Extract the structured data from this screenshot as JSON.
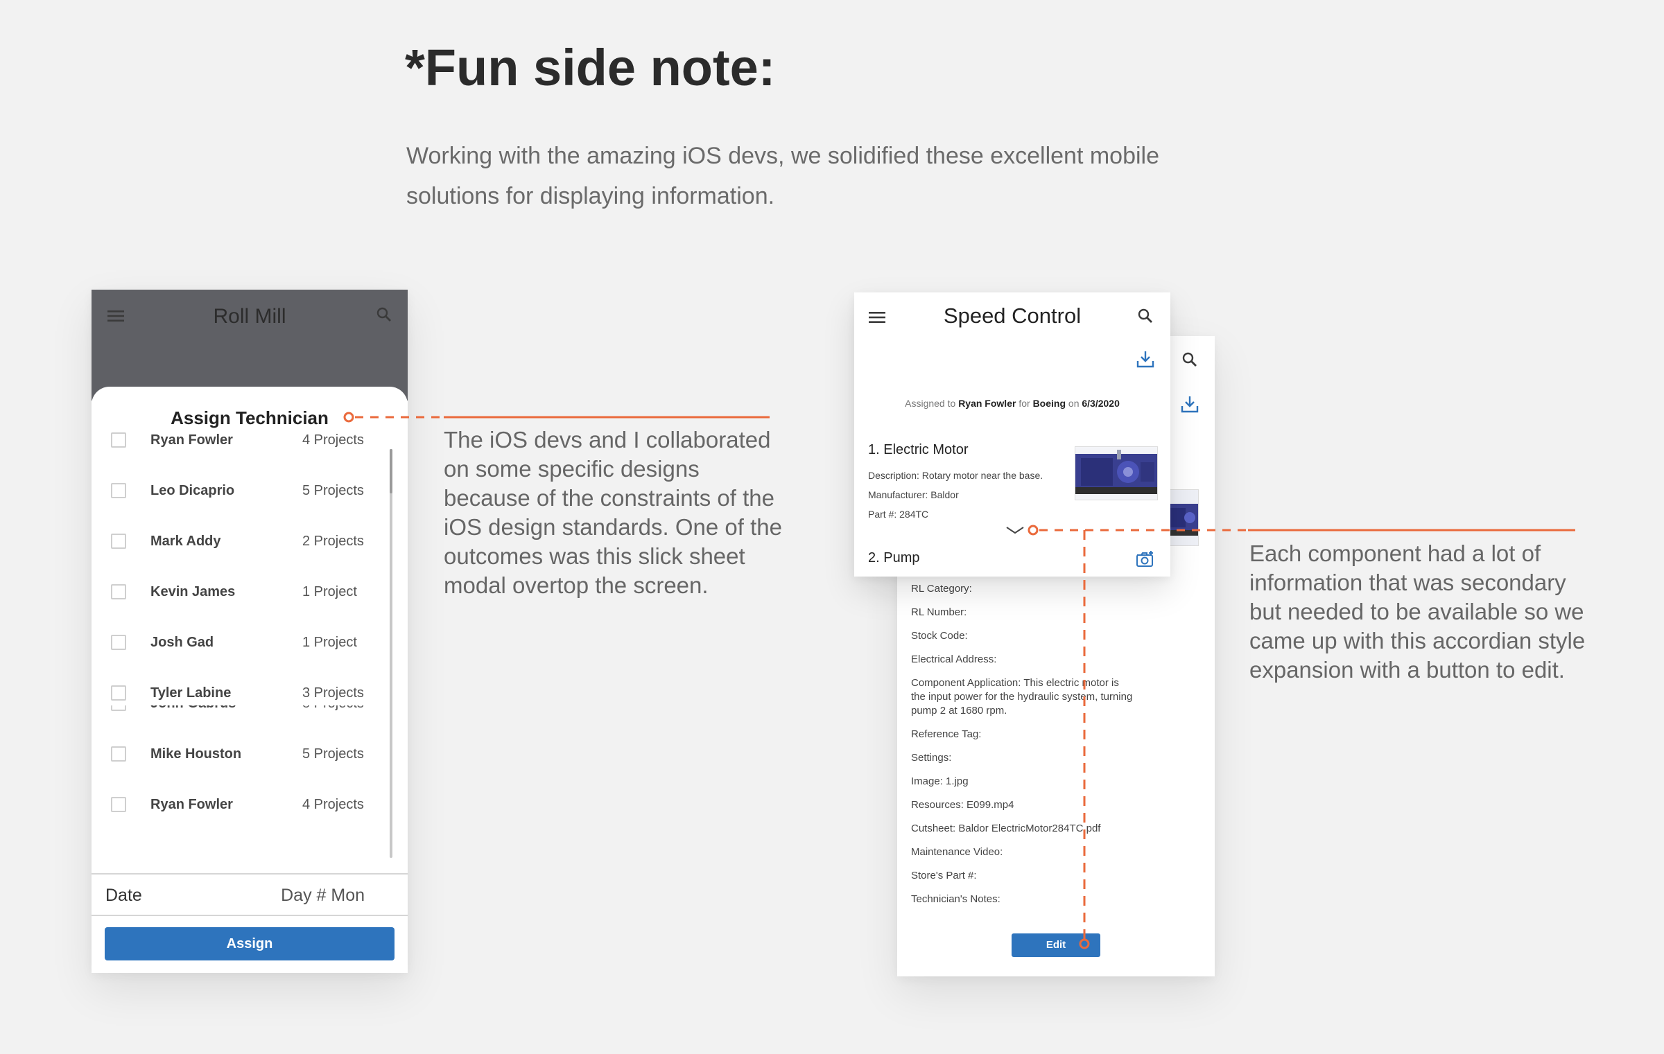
{
  "heading": "*Fun side note:",
  "intro": "Working with the amazing iOS devs, we solidified these excellent mobile solutions for displaying information.",
  "left_phone": {
    "app_title": "Roll Mill",
    "sheet_title": "Assign Technician",
    "technicians": [
      {
        "name": "Ryan Fowler",
        "projects": "4 Projects"
      },
      {
        "name": "Leo Dicaprio",
        "projects": "5 Projects"
      },
      {
        "name": "Mark Addy",
        "projects": "2 Projects"
      },
      {
        "name": "Kevin James",
        "projects": "1 Project"
      },
      {
        "name": "Josh Gad",
        "projects": "1 Project"
      },
      {
        "name": "Tyler Labine",
        "projects": "3 Projects"
      },
      {
        "name": "John Gabrus",
        "projects": "8 Projects"
      },
      {
        "name": "Mike Houston",
        "projects": "5 Projects"
      },
      {
        "name": "Ryan Fowler",
        "projects": "4 Projects"
      }
    ],
    "date_label": "Date",
    "date_value": "Day # Mon",
    "assign_label": "Assign"
  },
  "left_description": "The iOS devs and I collaborated on some specific designs because of the constraints of the iOS design standards. One of the outcomes was this slick sheet modal overtop the screen.",
  "right_front": {
    "title": "Speed Control",
    "assigned": {
      "prefix": "Assigned to",
      "tech": "Ryan Fowler",
      "for": "for",
      "company": "Boeing",
      "on": "on",
      "date": "6/3/2020"
    },
    "component_1": {
      "title": "1. Electric Motor",
      "description": "Description: Rotary motor near the base.",
      "manufacturer": "Manufacturer: Baldor",
      "part": "Part #: 284TC"
    },
    "component_2_title": "2. Pump"
  },
  "right_back": {
    "details": [
      "RL Category:",
      "RL Number:",
      "Stock Code:",
      "Electrical Address:",
      "Component Application: This electric motor is the input power for the hydraulic system, turning pump 2 at 1680 rpm.",
      "Reference Tag:",
      "Settings:",
      "Image: 1.jpg",
      "Resources: E099.mp4",
      "Cutsheet: Baldor ElectricMotor284TC.pdf",
      "Maintenance Video:",
      "Store's Part #:",
      "Technician's Notes:"
    ],
    "edit_label": "Edit"
  },
  "right_description": "Each component had a lot of information that was secondary but needed to be available so we came up with this accordian style expansion with a button to edit.",
  "colors": {
    "accent_orange": "#ea6a3c",
    "button_blue": "#2e74bd",
    "appbar_gray": "#5f6065",
    "background": "#f2f2f2"
  },
  "icons": [
    "menu-icon",
    "search-icon",
    "download-icon",
    "chevron-down-icon",
    "add-photo-icon"
  ]
}
